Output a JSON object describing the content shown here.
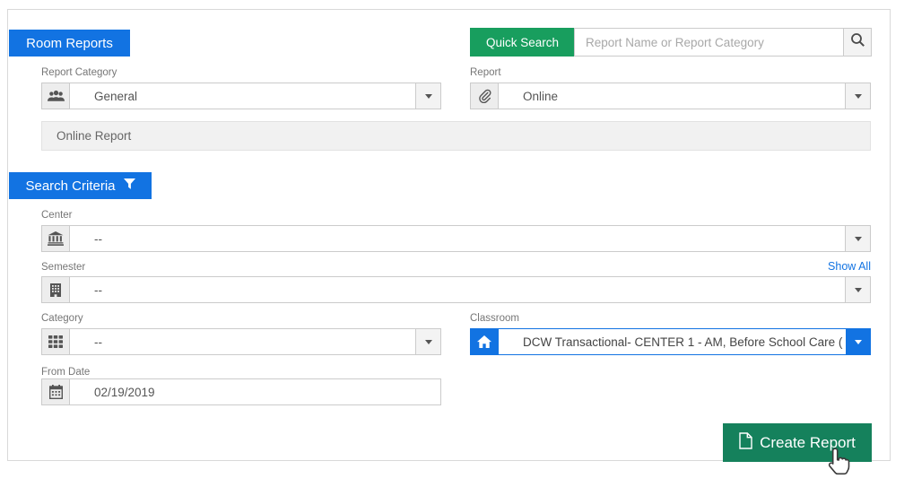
{
  "header": {
    "title": "Room Reports"
  },
  "quick_search": {
    "button_label": "Quick Search",
    "placeholder": "Report Name or Report Category",
    "value": ""
  },
  "report_category": {
    "label": "Report Category",
    "value": "General"
  },
  "report": {
    "label": "Report",
    "value": "Online"
  },
  "report_description": "Online Report",
  "search_criteria": {
    "title": "Search Criteria",
    "show_all_label": "Show All",
    "fields": {
      "center": {
        "label": "Center",
        "value": "--"
      },
      "semester": {
        "label": "Semester",
        "value": "--"
      },
      "category": {
        "label": "Category",
        "value": "--"
      },
      "classroom": {
        "label": "Classroom",
        "value": "DCW Transactional- CENTER 1 - AM, Before School Care ("
      },
      "from_date": {
        "label": "From Date",
        "value": "02/19/2019"
      }
    }
  },
  "actions": {
    "create_report_label": "Create Report"
  },
  "colors": {
    "accent_blue": "#1273e2",
    "quick_search_green": "#189e5e",
    "create_report_green": "#15815c",
    "link_blue": "#1273e2"
  },
  "icons": [
    "users-icon",
    "paperclip-icon",
    "bank-icon",
    "building-icon",
    "grid-icon",
    "home-icon",
    "calendar-icon",
    "search-icon",
    "filter-icon",
    "file-icon",
    "chevron-down-icon",
    "hand-cursor-icon"
  ]
}
